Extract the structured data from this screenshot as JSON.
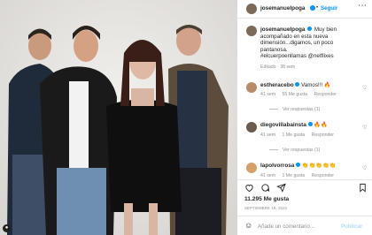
{
  "post": {
    "author": "josemanuelpoga",
    "follow": "Seguir",
    "caption_lines": [
      "Muy bien",
      "acompañado en esta nueva",
      "dimensión...digamos, un poco",
      "pantanosa.",
      "#elcuerpoenllamas @netflixes"
    ],
    "edited": "Editado · 38 sem"
  },
  "comments": [
    {
      "user": "estheracebo",
      "text": "Vamos!!! 🔥",
      "time": "41 sem",
      "likes": "55 Me gusta",
      "reply": "Responder",
      "view_replies": "Ver respuestas (1)"
    },
    {
      "user": "diegovillabainsta",
      "text": "🔥🔥",
      "time": "41 sem",
      "likes": "1 Me gusta",
      "reply": "Responder",
      "view_replies": "Ver respuestas (1)"
    },
    {
      "user": "lapolvorrosa",
      "text": "👏👏👏👏👏",
      "time": "41 sem",
      "likes": "1 Me gusta",
      "reply": "Responder"
    }
  ],
  "stats": {
    "likes": "11.295 Me gusta",
    "date": "SEPTIEMBRE 19, 2022"
  },
  "comment_box": {
    "placeholder": "Añade un comentario...",
    "post": "Publicar"
  },
  "icons": [
    "more-icon",
    "heart-icon",
    "comment-icon",
    "share-icon",
    "bookmark-icon",
    "emoji-icon"
  ],
  "colors": {
    "link": "#0095f6",
    "text": "#262626",
    "muted": "#8e8e8e"
  }
}
